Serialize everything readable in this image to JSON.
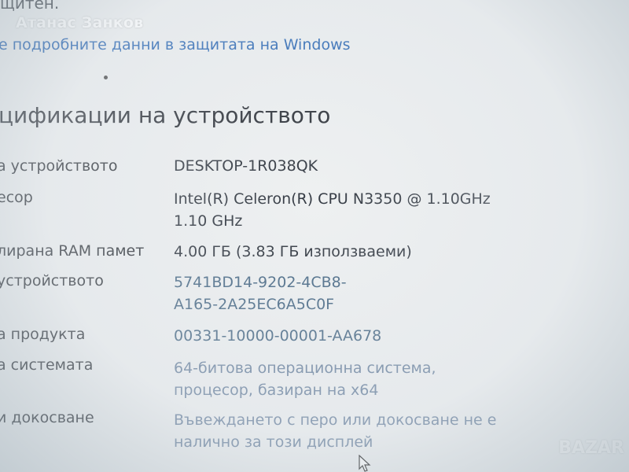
{
  "watermark": {
    "author": "Атанас Занков"
  },
  "top_fragment": "щитен.",
  "security_link": "е подробните данни в защитата на Windows",
  "section_title": "цификации на устройството",
  "specs": [
    {
      "label": "а устройството",
      "value_lines": [
        "DESKTOP-1R038QK"
      ]
    },
    {
      "label": "есор",
      "value_lines": [
        "Intel(R) Celeron(R) CPU N3350 @ 1.10GHz",
        "1.10 GHz"
      ]
    },
    {
      "label": "лирана RAM памет",
      "value_lines": [
        "4.00 ГБ (3.83 ГБ използваеми)"
      ]
    },
    {
      "label": "устройството",
      "value_lines": [
        "5741BD14-9202-4CB8-",
        "A165-2A25EC6A5C0F"
      ]
    },
    {
      "label": "а продукта",
      "value_lines": [
        "00331-10000-00001-AA678"
      ]
    },
    {
      "label": "а системата",
      "value_lines": [
        "64-битова операционна система,",
        "процесор, базиран на x64"
      ]
    },
    {
      "label": "и докосване",
      "value_lines": [
        "Въвеждането с перо или докосване не е",
        "налично за този дисплей"
      ]
    }
  ],
  "badge": "BAZAR"
}
